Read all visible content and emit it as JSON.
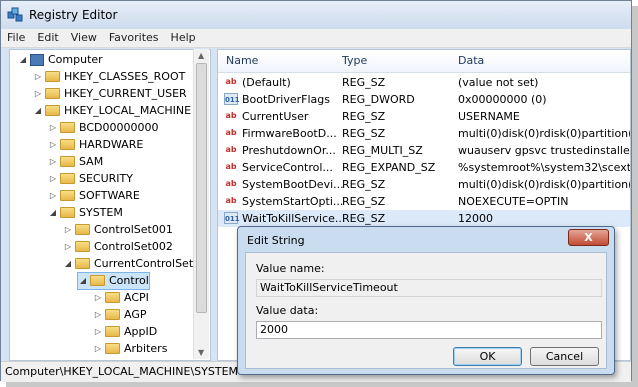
{
  "window": {
    "title": "Registry Editor"
  },
  "menu": [
    "File",
    "Edit",
    "View",
    "Favorites",
    "Help"
  ],
  "tree": [
    {
      "label": "Computer",
      "level": 0,
      "expanded": true,
      "icon": "computer-icon"
    },
    {
      "label": "HKEY_CLASSES_ROOT",
      "level": 1,
      "expanded": false
    },
    {
      "label": "HKEY_CURRENT_USER",
      "level": 1,
      "expanded": false
    },
    {
      "label": "HKEY_LOCAL_MACHINE",
      "level": 1,
      "expanded": true
    },
    {
      "label": "BCD00000000",
      "level": 2,
      "expanded": false
    },
    {
      "label": "HARDWARE",
      "level": 2,
      "expanded": false
    },
    {
      "label": "SAM",
      "level": 2,
      "expanded": false
    },
    {
      "label": "SECURITY",
      "level": 2,
      "expanded": false
    },
    {
      "label": "SOFTWARE",
      "level": 2,
      "expanded": false
    },
    {
      "label": "SYSTEM",
      "level": 2,
      "expanded": true
    },
    {
      "label": "ControlSet001",
      "level": 3,
      "expanded": false
    },
    {
      "label": "ControlSet002",
      "level": 3,
      "expanded": false
    },
    {
      "label": "CurrentControlSet",
      "level": 3,
      "expanded": true
    },
    {
      "label": "Control",
      "level": 4,
      "expanded": true,
      "selected": true
    },
    {
      "label": "ACPI",
      "level": 5,
      "expanded": false
    },
    {
      "label": "AGP",
      "level": 5,
      "expanded": false
    },
    {
      "label": "AppID",
      "level": 5,
      "expanded": false
    },
    {
      "label": "Arbiters",
      "level": 5,
      "expanded": false
    }
  ],
  "columns": {
    "name": "Name",
    "type": "Type",
    "data": "Data"
  },
  "values": [
    {
      "name": "(Default)",
      "type": "REG_SZ",
      "data": "(value not set)",
      "icon": "string-value-icon"
    },
    {
      "name": "BootDriverFlags",
      "type": "REG_DWORD",
      "data": "0x00000000 (0)",
      "icon": "binary-value-icon"
    },
    {
      "name": "CurrentUser",
      "type": "REG_SZ",
      "data": "USERNAME",
      "icon": "string-value-icon"
    },
    {
      "name": "FirmwareBootD...",
      "type": "REG_SZ",
      "data": "multi(0)disk(0)rdisk(0)partition(2)",
      "icon": "string-value-icon"
    },
    {
      "name": "PreshutdownOr...",
      "type": "REG_MULTI_SZ",
      "data": "wuauserv gpsvc trustedinstaller",
      "icon": "string-value-icon"
    },
    {
      "name": "ServiceControl...",
      "type": "REG_EXPAND_SZ",
      "data": "%systemroot%\\system32\\scext.dll",
      "icon": "string-value-icon"
    },
    {
      "name": "SystemBootDevi...",
      "type": "REG_SZ",
      "data": "multi(0)disk(0)rdisk(0)partition(3)",
      "icon": "string-value-icon"
    },
    {
      "name": "SystemStartOpti...",
      "type": "REG_SZ",
      "data": " NOEXECUTE=OPTIN",
      "icon": "string-value-icon"
    },
    {
      "name": "WaitToKillService...",
      "type": "REG_SZ",
      "data": "12000",
      "icon": "binary-value-icon",
      "selected": true
    }
  ],
  "status": "Computer\\HKEY_LOCAL_MACHINE\\SYSTEM",
  "dialog": {
    "title": "Edit String",
    "close": "X",
    "value_name_label": "Value name:",
    "value_name": "WaitToKillServiceTimeout",
    "value_data_label": "Value data:",
    "value_data": "2000",
    "ok": "OK",
    "cancel": "Cancel"
  }
}
